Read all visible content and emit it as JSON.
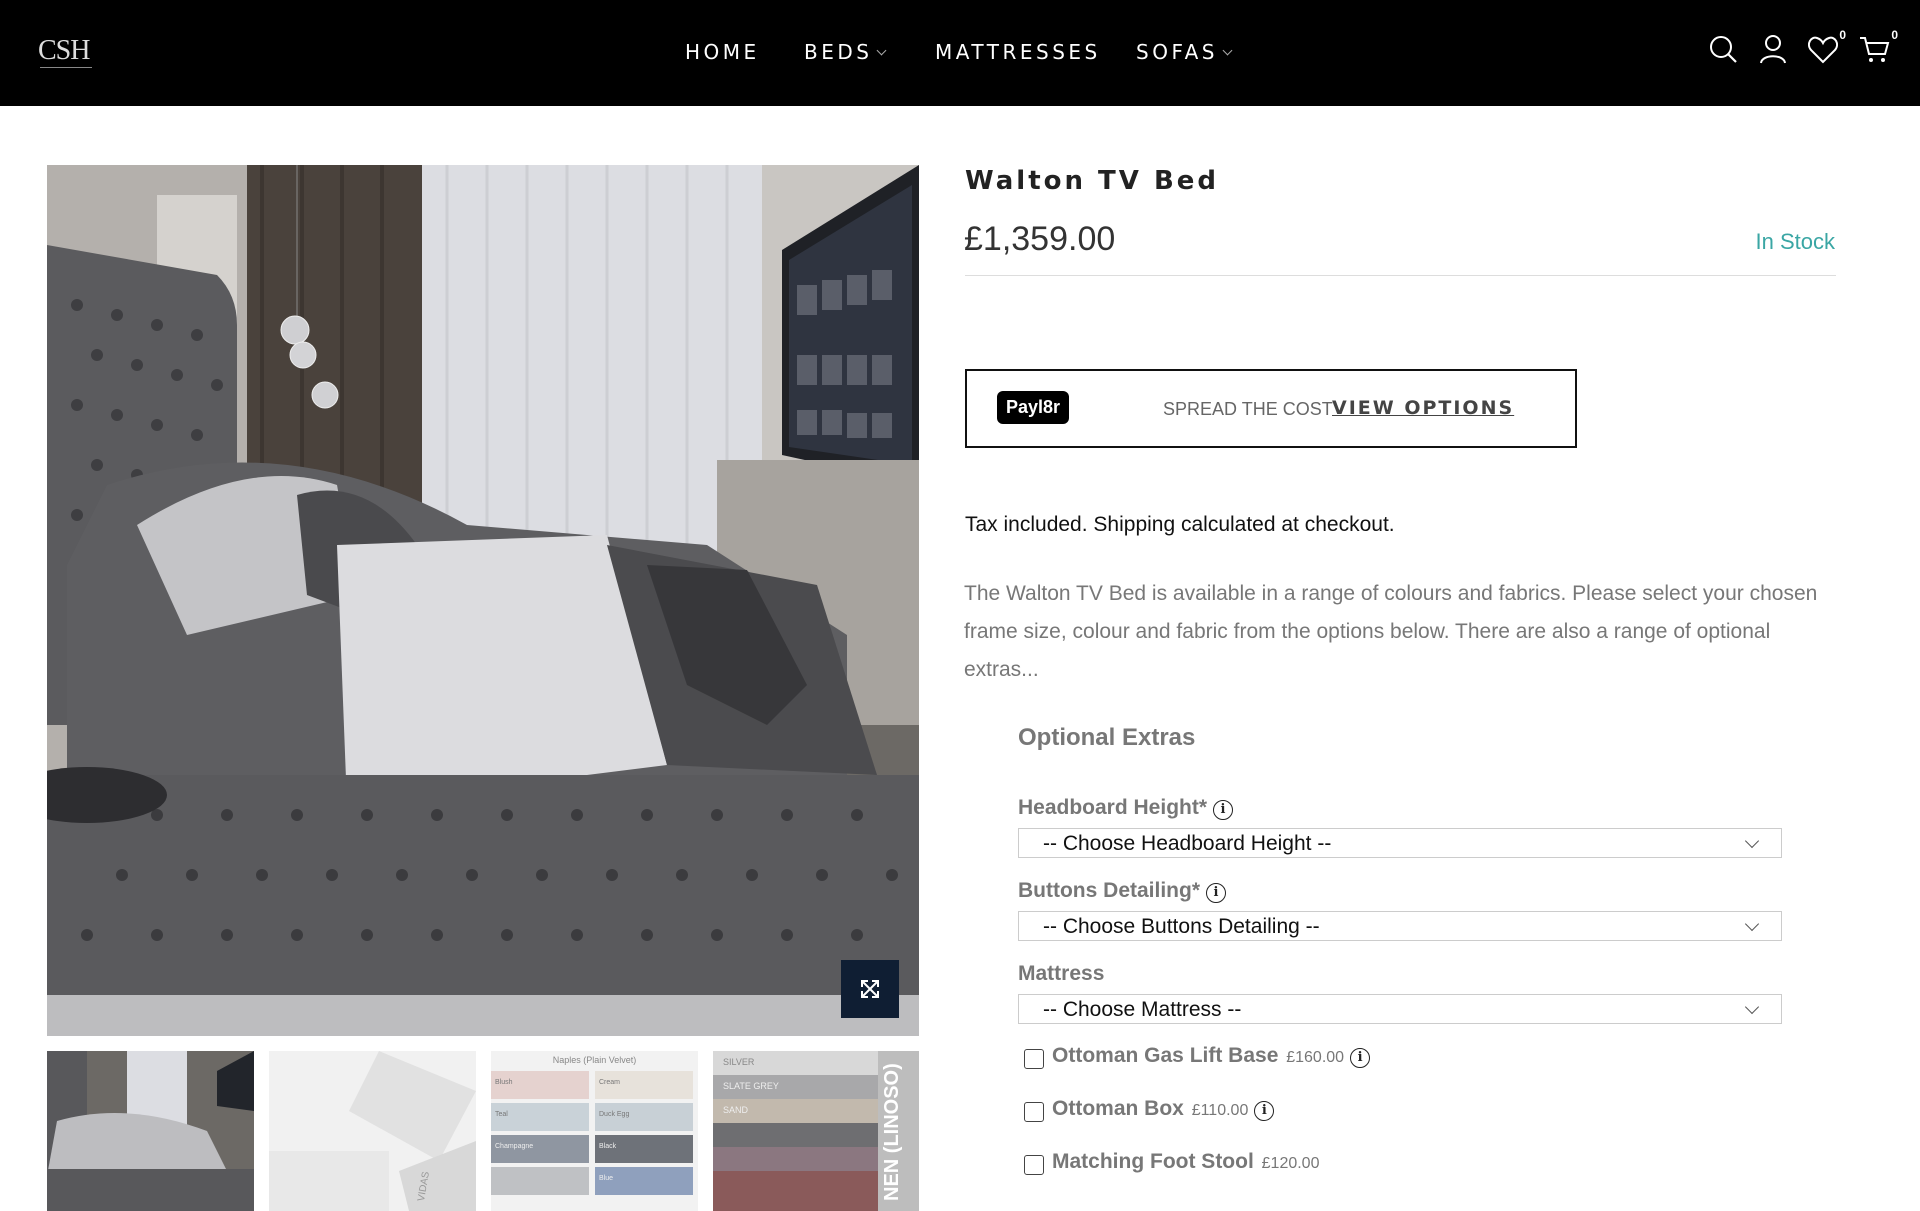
{
  "header": {
    "logo": "CSH",
    "nav": [
      {
        "label": "HOME",
        "has_dropdown": false
      },
      {
        "label": "BEDS",
        "has_dropdown": true
      },
      {
        "label": "MATTRESSES",
        "has_dropdown": false
      },
      {
        "label": "SOFAS",
        "has_dropdown": true
      }
    ],
    "icons": [
      "search-icon",
      "account-icon",
      "wishlist-icon",
      "cart-icon"
    ],
    "wishlist_count": "0",
    "cart_count": "0"
  },
  "product": {
    "title": "Walton TV Bed",
    "price": "£1,359.00",
    "stock": "In Stock",
    "payl8r": {
      "badge": "Payl8r",
      "spread": "SPREAD THE COST",
      "view": "VIEW OPTIONS"
    },
    "tax_note": "Tax included. Shipping calculated at checkout.",
    "description": "The Walton TV Bed is available in a range of colours and fabrics.  Please select your chosen frame size, colour and fabric from the options below.  There are also a range of optional extras...",
    "gallery_thumbs": 4
  },
  "options": {
    "title": "Optional Extras",
    "selects": [
      {
        "label": "Headboard Height*",
        "value": "-- Choose Headboard Height --",
        "has_info": true
      },
      {
        "label": "Buttons Detailing*",
        "value": "-- Choose Buttons Detailing --",
        "has_info": true
      },
      {
        "label": "Mattress",
        "value": "-- Choose Mattress --",
        "has_info": false
      }
    ],
    "checkboxes": [
      {
        "label": "Ottoman Gas Lift Base",
        "price": "£160.00",
        "has_info": true,
        "checked": false
      },
      {
        "label": "Ottoman Box",
        "price": "£110.00",
        "has_info": true,
        "checked": false
      },
      {
        "label": "Matching Foot Stool",
        "price": "£120.00",
        "has_info": false,
        "checked": false
      }
    ]
  },
  "thumb_text": {
    "t3_title": "Naples (Plain Velvet)",
    "t3_swatches": [
      "Blush",
      "Cream",
      "Teal",
      "Duck Egg",
      "Champagne",
      "Black",
      "",
      "Blue"
    ],
    "t4_swatches": [
      "SILVER",
      "SLATE GREY",
      "SAND",
      "",
      "",
      ""
    ],
    "t4_side": "NEN (LINOSO)",
    "t2_side": "VIDAS"
  },
  "colors": {
    "header_bg": "#000000",
    "accent_stock": "#3aa6a4",
    "expand_btn": "#0f1e33"
  }
}
